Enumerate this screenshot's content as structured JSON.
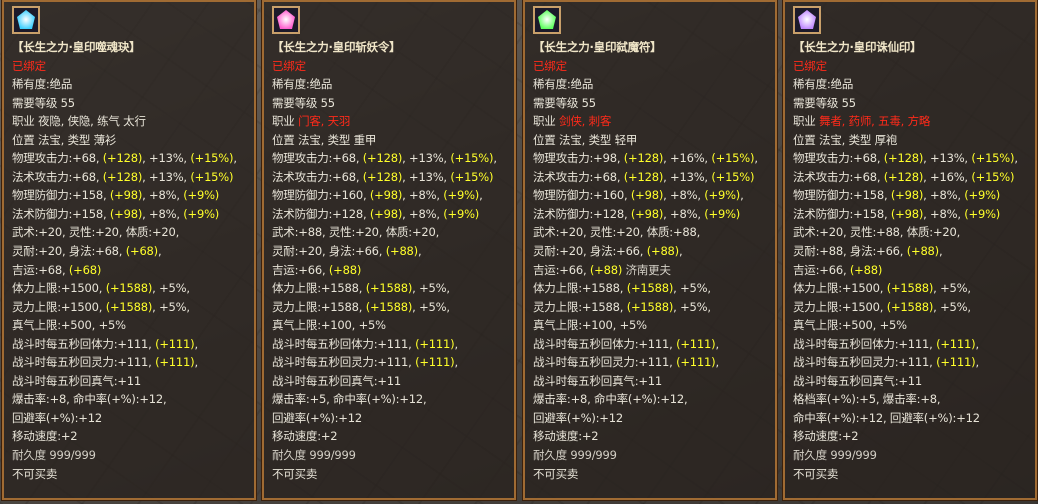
{
  "panels": [
    {
      "icon": "jade-amulet-icon",
      "icon_color": "#3fd0ff",
      "name": "【长生之力·皇印噬魂玦】",
      "bound": "已绑定",
      "rarity": "稀有度:绝品",
      "level": "需要等级 55",
      "job_prefix": "职业 ",
      "job_text": "夜隐, 侠隐, 练气  太行",
      "job_red": false,
      "slot": "位置  法宝,  类型  薄衫",
      "stats": [
        {
          "a": "物理攻击力:+68, ",
          "b": "(+128)",
          "c": ", +13%, ",
          "d": "(+15%)",
          "e": ","
        },
        {
          "a": "法术攻击力:+68, ",
          "b": "(+128)",
          "c": ", +13%, ",
          "d": "(+15%)",
          "e": ""
        },
        {
          "a": "物理防御力:+158, ",
          "b": "(+98)",
          "c": ", +8%, ",
          "d": "(+9%)",
          "e": ""
        },
        {
          "a": "法术防御力:+158, ",
          "b": "(+98)",
          "c": ", +8%, ",
          "d": "(+9%)",
          "e": ""
        },
        {
          "a": "武术:+20, 灵性:+20, 体质:+20,",
          "b": "",
          "c": "",
          "d": "",
          "e": ""
        },
        {
          "a": "灵耐:+20, 身法:+68, ",
          "b": "(+68)",
          "c": ",",
          "d": "",
          "e": ""
        },
        {
          "a": "吉运:+68, ",
          "b": "(+68)",
          "c": "",
          "d": "",
          "e": ""
        },
        {
          "a": "体力上限:+1500, ",
          "b": "(+1588)",
          "c": ", +5%,",
          "d": "",
          "e": ""
        },
        {
          "a": "灵力上限:+1500, ",
          "b": "(+1588)",
          "c": ", +5%,",
          "d": "",
          "e": ""
        },
        {
          "a": "真气上限:+500, +5%",
          "b": "",
          "c": "",
          "d": "",
          "e": ""
        },
        {
          "a": "战斗时每五秒回体力:+111, ",
          "b": "(+111)",
          "c": ",",
          "d": "",
          "e": ""
        },
        {
          "a": "战斗时每五秒回灵力:+111, ",
          "b": "(+111)",
          "c": ",",
          "d": "",
          "e": ""
        },
        {
          "a": "战斗时每五秒回真气:+11",
          "b": "",
          "c": "",
          "d": "",
          "e": ""
        },
        {
          "a": "爆击率:+8, 命中率(+%):+12,",
          "b": "",
          "c": "",
          "d": "",
          "e": ""
        },
        {
          "a": "回避率(+%):+12",
          "b": "",
          "c": "",
          "d": "",
          "e": ""
        },
        {
          "a": "移动速度:+2",
          "b": "",
          "c": "",
          "d": "",
          "e": ""
        }
      ],
      "durability": "耐久度 999/999",
      "no_sell": "不可买卖"
    },
    {
      "icon": "demon-token-icon",
      "icon_color": "#ff5fd0",
      "name": "【长生之力·皇印斩妖令】",
      "bound": "已绑定",
      "rarity": "稀有度:绝品",
      "level": "需要等级 55",
      "job_prefix": "职业 ",
      "job_text": "门客, 天羽",
      "job_red": true,
      "slot": "位置  法宝,  类型  重甲",
      "stats": [
        {
          "a": "物理攻击力:+68, ",
          "b": "(+128)",
          "c": ", +13%, ",
          "d": "(+15%)",
          "e": ","
        },
        {
          "a": "法术攻击力:+68, ",
          "b": "(+128)",
          "c": ", +13%, ",
          "d": "(+15%)",
          "e": ""
        },
        {
          "a": "物理防御力:+160, ",
          "b": "(+98)",
          "c": ", +8%, ",
          "d": "(+9%)",
          "e": ","
        },
        {
          "a": "法术防御力:+128, ",
          "b": "(+98)",
          "c": ", +8%, ",
          "d": "(+9%)",
          "e": ""
        },
        {
          "a": "武术:+88, 灵性:+20, 体质:+20,",
          "b": "",
          "c": "",
          "d": "",
          "e": ""
        },
        {
          "a": "灵耐:+20, 身法:+66, ",
          "b": "(+88)",
          "c": ",",
          "d": "",
          "e": ""
        },
        {
          "a": "吉运:+66, ",
          "b": "(+88)",
          "c": "",
          "d": "",
          "e": ""
        },
        {
          "a": "体力上限:+1588, ",
          "b": "(+1588)",
          "c": ", +5%,",
          "d": "",
          "e": ""
        },
        {
          "a": "灵力上限:+1588, ",
          "b": "(+1588)",
          "c": ", +5%,",
          "d": "",
          "e": ""
        },
        {
          "a": "真气上限:+100, +5%",
          "b": "",
          "c": "",
          "d": "",
          "e": ""
        },
        {
          "a": "战斗时每五秒回体力:+111, ",
          "b": "(+111)",
          "c": ",",
          "d": "",
          "e": ""
        },
        {
          "a": "战斗时每五秒回灵力:+111, ",
          "b": "(+111)",
          "c": ",",
          "d": "",
          "e": ""
        },
        {
          "a": "战斗时每五秒回真气:+11",
          "b": "",
          "c": "",
          "d": "",
          "e": ""
        },
        {
          "a": "爆击率:+5, 命中率(+%):+12,",
          "b": "",
          "c": "",
          "d": "",
          "e": ""
        },
        {
          "a": "回避率(+%):+12",
          "b": "",
          "c": "",
          "d": "",
          "e": ""
        },
        {
          "a": "移动速度:+2",
          "b": "",
          "c": "",
          "d": "",
          "e": ""
        }
      ],
      "durability": "耐久度 999/999",
      "no_sell": "不可买卖"
    },
    {
      "icon": "demon-talisman-icon",
      "icon_color": "#5fff5f",
      "name": "【长生之力·皇印弑魔符】",
      "bound": "已绑定",
      "rarity": "稀有度:绝品",
      "level": "需要等级 55",
      "job_prefix": "职业 ",
      "job_text": "剑侠, 刺客",
      "job_red": true,
      "slot": "位置  法宝,  类型  轻甲",
      "stats": [
        {
          "a": "物理攻击力:+98, ",
          "b": "(+128)",
          "c": ", +16%, ",
          "d": "(+15%)",
          "e": ","
        },
        {
          "a": "法术攻击力:+68, ",
          "b": "(+128)",
          "c": ", +13%, ",
          "d": "(+15%)",
          "e": ""
        },
        {
          "a": "物理防御力:+160, ",
          "b": "(+98)",
          "c": ", +8%, ",
          "d": "(+9%)",
          "e": ","
        },
        {
          "a": "法术防御力:+128, ",
          "b": "(+98)",
          "c": ", +8%, ",
          "d": "(+9%)",
          "e": ""
        },
        {
          "a": "武术:+20, 灵性:+20, 体质:+88,",
          "b": "",
          "c": "",
          "d": "",
          "e": ""
        },
        {
          "a": "灵耐:+20, 身法:+66, ",
          "b": "(+88)",
          "c": ",",
          "d": "",
          "e": ""
        },
        {
          "a": "吉运:+66, ",
          "b": "(+88)",
          "c": "  济南更夫",
          "d": "",
          "e": ""
        },
        {
          "a": "体力上限:+1588, ",
          "b": "(+1588)",
          "c": ", +5%,",
          "d": "",
          "e": ""
        },
        {
          "a": "灵力上限:+1588, ",
          "b": "(+1588)",
          "c": ", +5%,",
          "d": "",
          "e": ""
        },
        {
          "a": "真气上限:+100, +5%",
          "b": "",
          "c": "",
          "d": "",
          "e": ""
        },
        {
          "a": "战斗时每五秒回体力:+111, ",
          "b": "(+111)",
          "c": ",",
          "d": "",
          "e": ""
        },
        {
          "a": "战斗时每五秒回灵力:+111, ",
          "b": "(+111)",
          "c": ",",
          "d": "",
          "e": ""
        },
        {
          "a": "战斗时每五秒回真气:+11",
          "b": "",
          "c": "",
          "d": "",
          "e": ""
        },
        {
          "a": "爆击率:+8, 命中率(+%):+12,",
          "b": "",
          "c": "",
          "d": "",
          "e": ""
        },
        {
          "a": "回避率(+%):+12",
          "b": "",
          "c": "",
          "d": "",
          "e": ""
        },
        {
          "a": "移动速度:+2",
          "b": "",
          "c": "",
          "d": "",
          "e": ""
        }
      ],
      "durability": "耐久度 999/999",
      "no_sell": "不可买卖"
    },
    {
      "icon": "immortal-seal-icon",
      "icon_color": "#c08aff",
      "name": "【长生之力·皇印诛仙印】",
      "bound": "已绑定",
      "rarity": "稀有度:绝品",
      "level": "需要等级 55",
      "job_prefix": "职业 ",
      "job_text": "舞者, 药师, 五毒, 方略",
      "job_red": true,
      "slot": "位置  法宝,  类型  厚袍",
      "stats": [
        {
          "a": "物理攻击力:+68, ",
          "b": "(+128)",
          "c": ", +13%, ",
          "d": "(+15%)",
          "e": ","
        },
        {
          "a": "法术攻击力:+68, ",
          "b": "(+128)",
          "c": ", +16%, ",
          "d": "(+15%)",
          "e": ""
        },
        {
          "a": "物理防御力:+158, ",
          "b": "(+98)",
          "c": ", +8%, ",
          "d": "(+9%)",
          "e": ""
        },
        {
          "a": "法术防御力:+158, ",
          "b": "(+98)",
          "c": ", +8%, ",
          "d": "(+9%)",
          "e": ""
        },
        {
          "a": "武术:+20, 灵性:+88, 体质:+20,",
          "b": "",
          "c": "",
          "d": "",
          "e": ""
        },
        {
          "a": "灵耐:+88, 身法:+66, ",
          "b": "(+88)",
          "c": ",",
          "d": "",
          "e": ""
        },
        {
          "a": "吉运:+66, ",
          "b": "(+88)",
          "c": "",
          "d": "",
          "e": ""
        },
        {
          "a": "体力上限:+1500, ",
          "b": "(+1588)",
          "c": ", +5%,",
          "d": "",
          "e": ""
        },
        {
          "a": "灵力上限:+1500, ",
          "b": "(+1588)",
          "c": ", +5%,",
          "d": "",
          "e": ""
        },
        {
          "a": "真气上限:+500, +5%",
          "b": "",
          "c": "",
          "d": "",
          "e": ""
        },
        {
          "a": "战斗时每五秒回体力:+111, ",
          "b": "(+111)",
          "c": ",",
          "d": "",
          "e": ""
        },
        {
          "a": "战斗时每五秒回灵力:+111, ",
          "b": "(+111)",
          "c": ",",
          "d": "",
          "e": ""
        },
        {
          "a": "战斗时每五秒回真气:+11",
          "b": "",
          "c": "",
          "d": "",
          "e": ""
        },
        {
          "a": "格档率(+%):+5, 爆击率:+8,",
          "b": "",
          "c": "",
          "d": "",
          "e": ""
        },
        {
          "a": "命中率(+%):+12, 回避率(+%):+12",
          "b": "",
          "c": "",
          "d": "",
          "e": ""
        },
        {
          "a": "移动速度:+2",
          "b": "",
          "c": "",
          "d": "",
          "e": ""
        }
      ],
      "durability": "耐久度 999/999",
      "no_sell": "不可买卖"
    }
  ]
}
